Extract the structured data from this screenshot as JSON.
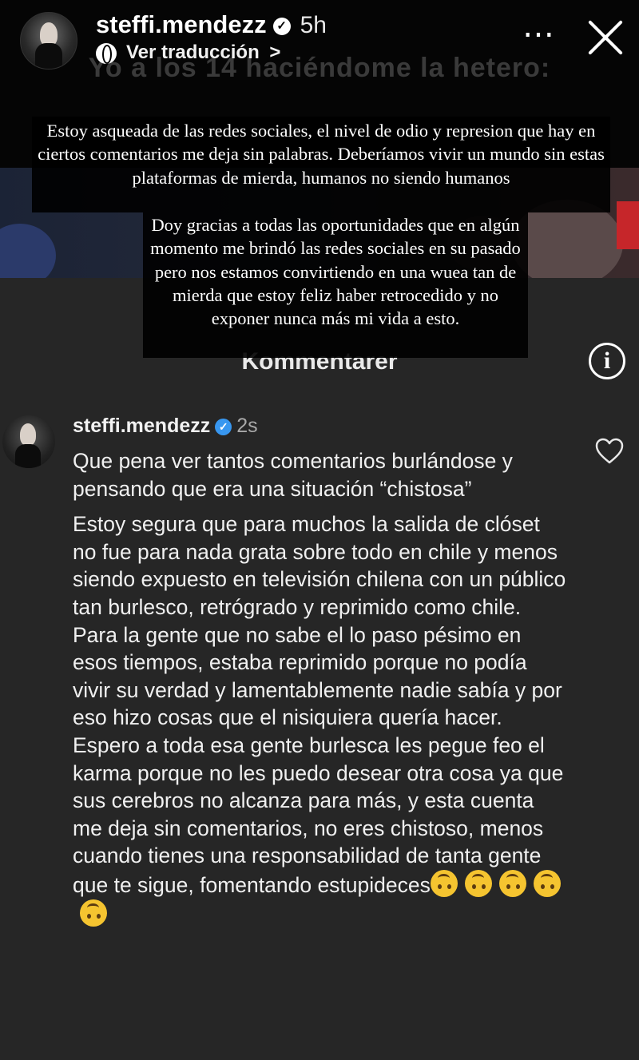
{
  "story": {
    "username": "steffi.mendezz",
    "time": "5h",
    "translate_label": "Ver traducción",
    "translate_chevron": ">",
    "more_icon": "⋯",
    "background_caption": "Yo a los 14 haciéndome la hetero:",
    "background_heading": "Kommentarer",
    "text_block_1": "Estoy asqueada de las redes sociales, el nivel de odio y represion que hay en ciertos comentarios me deja sin palabras. Deberíamos vivir un mundo sin estas plataformas de mierda, humanos no siendo humanos",
    "text_block_2": "Doy gracias a todas las oportunidades que en algún momento me brindó las redes sociales en su pasado pero nos estamos convirtiendo en una wuea tan de mierda que estoy feliz haber retrocedido y no exponer nunca más mi vida a esto."
  },
  "comment": {
    "username": "steffi.mendezz",
    "time": "2s",
    "paragraph_1": "Que pena ver tantos comentarios burlándose y pensando que era una situación “chistosa”",
    "paragraph_2": "Estoy segura que para muchos la salida de clóset no fue para nada grata sobre todo en chile y menos siendo expuesto en televisión chilena con un público tan burlesco, retrógrado y reprimido como chile. Para la gente que no sabe el lo paso pésimo en esos tiempos, estaba reprimido porque no podía vivir su verdad y lamentablemente nadie sabía y por eso hizo cosas que el nisiquiera quería hacer. Espero a toda esa gente burlesca les pegue feo el karma porque no les puedo desear otra cosa ya que sus cerebros no alcanza para más, y esta cuenta me deja sin comentarios, no eres chistoso, menos cuando tienes una responsabilidad de tanta gente que te sigue, fomentando estupideces",
    "emoji_icons": [
      "upside-down-face-icon",
      "upside-down-face-icon",
      "upside-down-face-icon",
      "upside-down-face-icon",
      "upside-down-face-icon"
    ]
  },
  "colors": {
    "story_background": "#050505",
    "comment_background": "#262626",
    "verified_badge": "#3897f0",
    "secondary_text": "#a8a8a8"
  }
}
